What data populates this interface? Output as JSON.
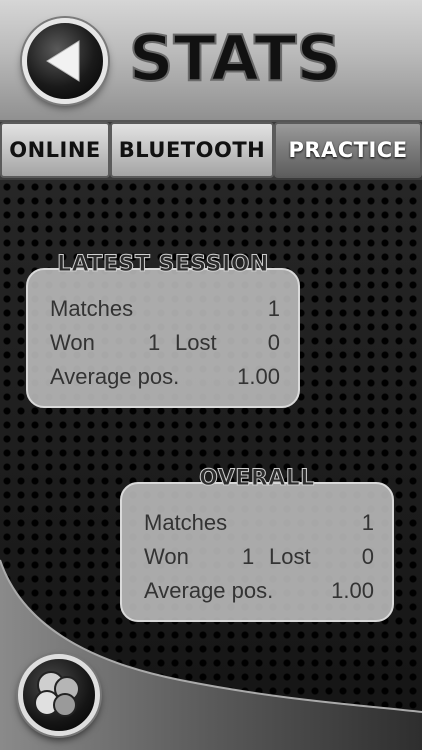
{
  "header": {
    "title": "STATS",
    "back_icon": "back-arrow-icon"
  },
  "tabs": [
    {
      "label": "ONLINE",
      "active": false
    },
    {
      "label": "BLUETOOTH",
      "active": false
    },
    {
      "label": "PRACTICE",
      "active": true
    }
  ],
  "latest_session": {
    "title": "LATEST SESSION",
    "matches_label": "Matches",
    "matches_value": "1",
    "won_label": "Won",
    "won_value": "1",
    "lost_label": "Lost",
    "lost_value": "0",
    "avg_label": "Average pos.",
    "avg_value": "1.00"
  },
  "overall": {
    "title": "OVERALL",
    "matches_label": "Matches",
    "matches_value": "1",
    "won_label": "Won",
    "won_value": "1",
    "lost_label": "Lost",
    "lost_value": "0",
    "avg_label": "Average pos.",
    "avg_value": "1.00"
  },
  "footer": {
    "badge_icon": "game-pieces-icon"
  }
}
